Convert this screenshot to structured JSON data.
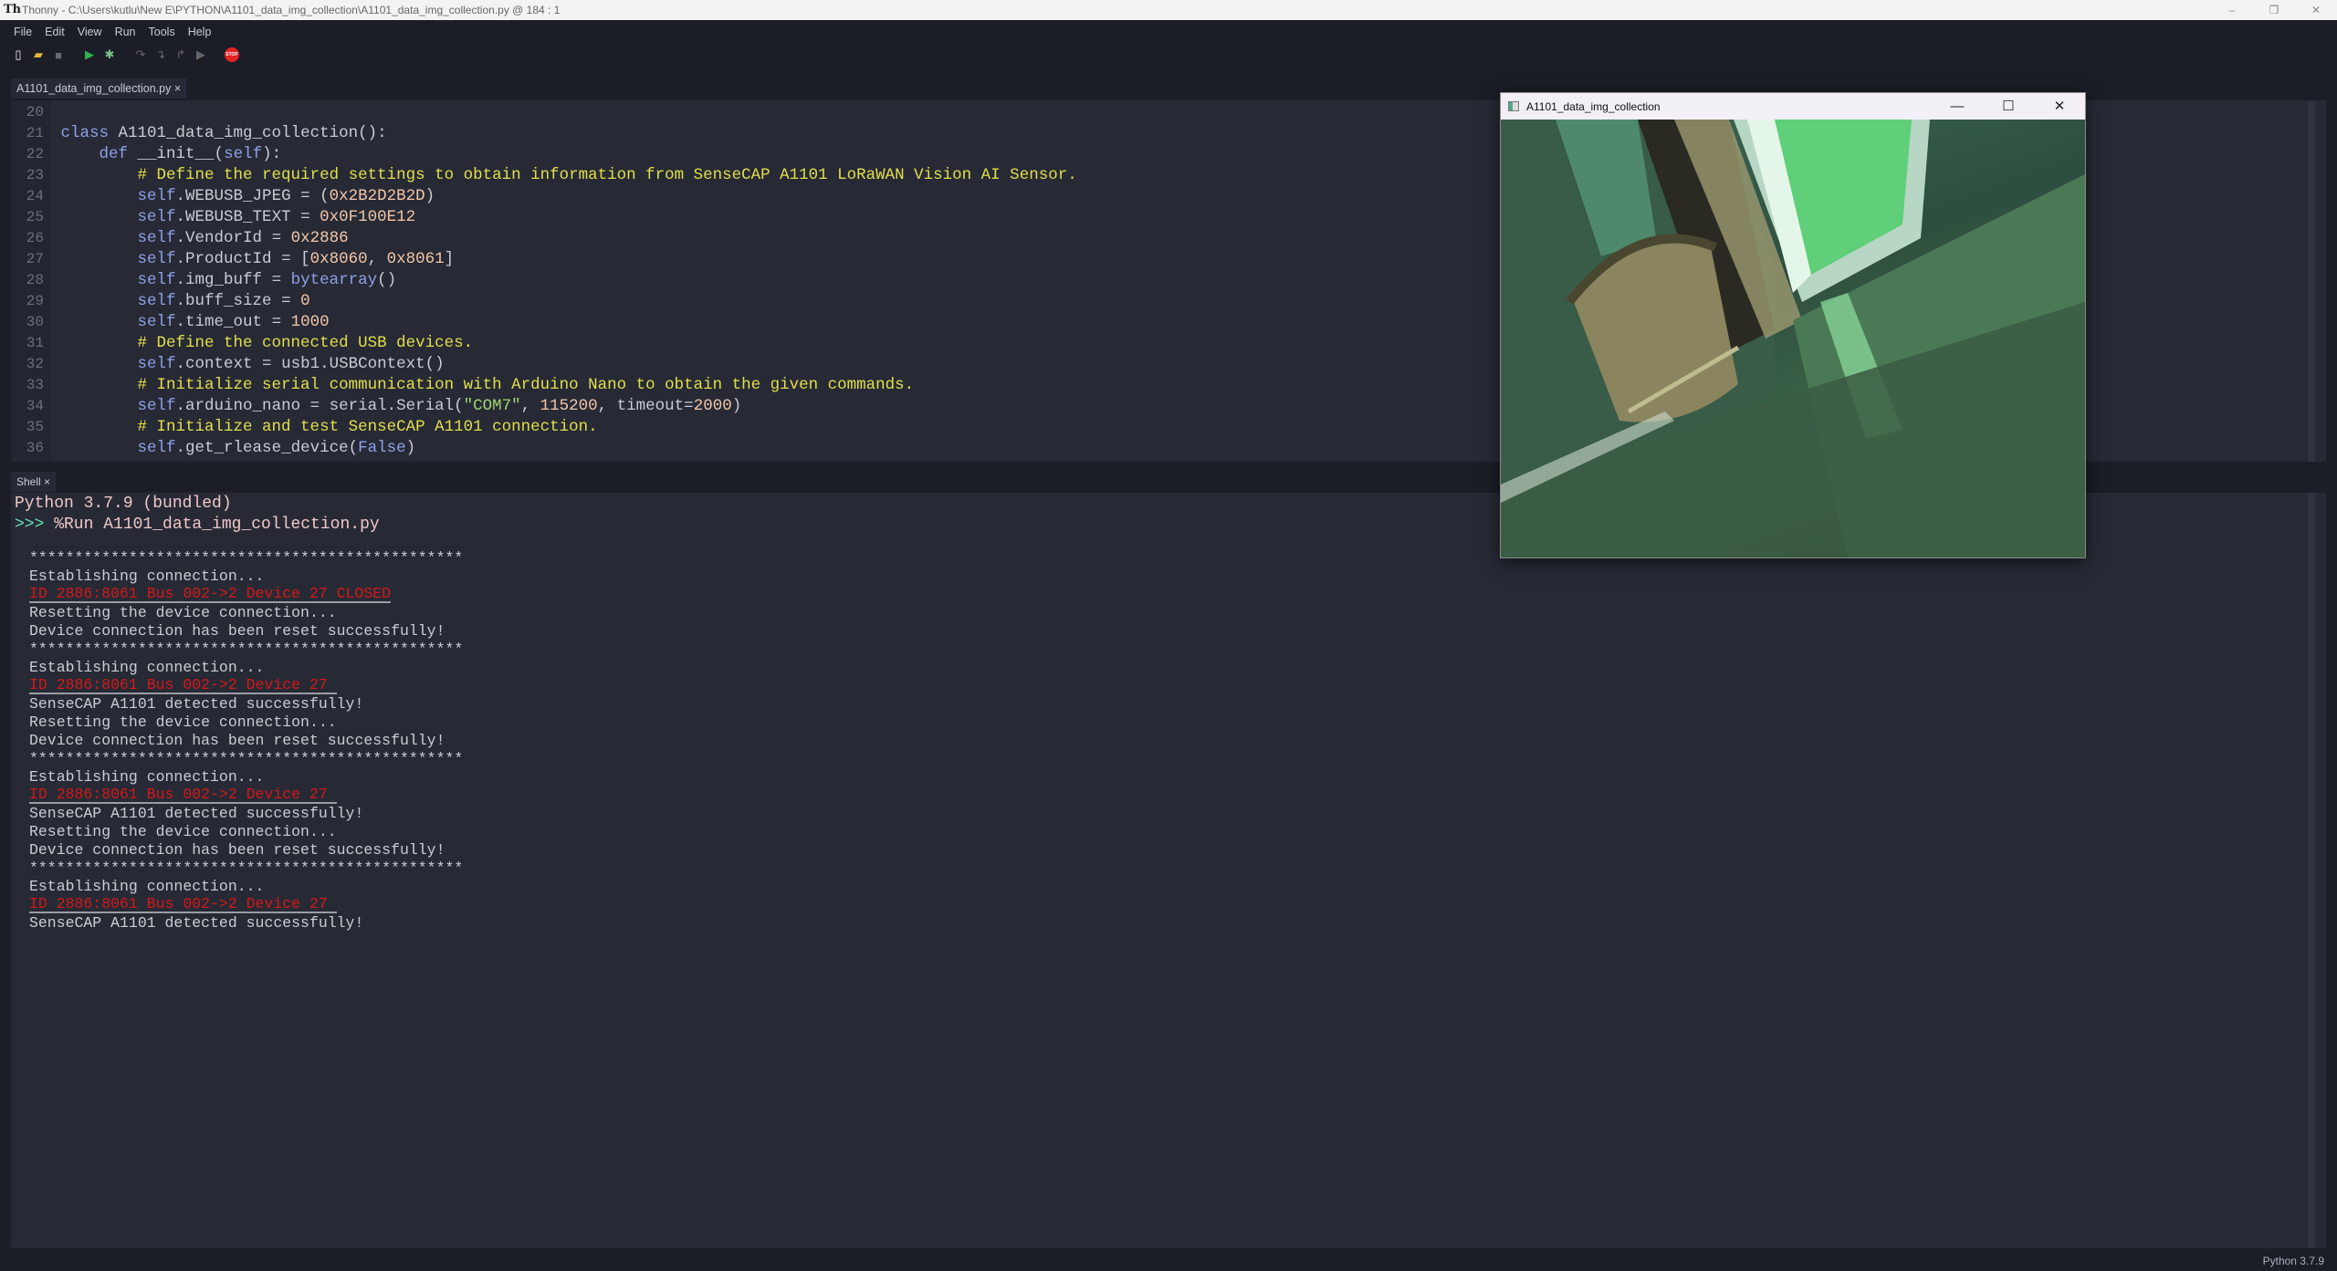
{
  "window": {
    "title": "Thonny  -  C:\\Users\\kutlu\\New E\\PYTHON\\A1101_data_img_collection\\A1101_data_img_collection.py  @  184 : 1",
    "minimize": "–",
    "maximize": "❐",
    "close": "✕"
  },
  "menu": [
    "File",
    "Edit",
    "View",
    "Run",
    "Tools",
    "Help"
  ],
  "toolbar": [
    {
      "icon": "new-file-icon",
      "glyph": "▯",
      "color": "#f0f0f0"
    },
    {
      "icon": "open-folder-icon",
      "glyph": "▰",
      "color": "#e6b63c"
    },
    {
      "icon": "save-icon",
      "glyph": "■",
      "color": "#666a75"
    },
    {
      "icon": "run-icon",
      "glyph": "▶",
      "color": "#2db34a"
    },
    {
      "icon": "debug-icon",
      "glyph": "✱",
      "color": "#7cc08a"
    },
    {
      "icon": "step-over-icon",
      "glyph": "↷",
      "color": "#666"
    },
    {
      "icon": "step-into-icon",
      "glyph": "↴",
      "color": "#666"
    },
    {
      "icon": "step-out-icon",
      "glyph": "↱",
      "color": "#666"
    },
    {
      "icon": "resume-icon",
      "glyph": "▶",
      "color": "#666"
    },
    {
      "icon": "stop-icon",
      "glyph": "STOP",
      "color": "#e52222"
    }
  ],
  "editor_tab": {
    "label": "A1101_data_img_collection.py",
    "close": "×"
  },
  "code": [
    {
      "n": "20",
      "t": []
    },
    {
      "n": "21",
      "t": [
        [
          "kw",
          "class"
        ],
        [
          "df",
          " A1101_data_img_collection():"
        ]
      ]
    },
    {
      "n": "22",
      "t": [
        [
          "df",
          "    "
        ],
        [
          "kw",
          "def"
        ],
        [
          "df",
          " __init__("
        ],
        [
          "kw",
          "self"
        ],
        [
          "df",
          "):"
        ]
      ]
    },
    {
      "n": "23",
      "t": [
        [
          "df",
          "        "
        ],
        [
          "cm",
          "# Define the required settings to obtain information from SenseCAP A1101 LoRaWAN Vision AI Sensor."
        ]
      ]
    },
    {
      "n": "24",
      "t": [
        [
          "df",
          "        "
        ],
        [
          "kw",
          "self"
        ],
        [
          "df",
          ".WEBUSB_JPEG = ("
        ],
        [
          "nu",
          "0x2B2D2B2D"
        ],
        [
          "df",
          ")"
        ]
      ]
    },
    {
      "n": "25",
      "t": [
        [
          "df",
          "        "
        ],
        [
          "kw",
          "self"
        ],
        [
          "df",
          ".WEBUSB_TEXT = "
        ],
        [
          "nu",
          "0x0F100E12"
        ]
      ]
    },
    {
      "n": "26",
      "t": [
        [
          "df",
          "        "
        ],
        [
          "kw",
          "self"
        ],
        [
          "df",
          ".VendorId = "
        ],
        [
          "nu",
          "0x2886"
        ]
      ]
    },
    {
      "n": "27",
      "t": [
        [
          "df",
          "        "
        ],
        [
          "kw",
          "self"
        ],
        [
          "df",
          ".ProductId = ["
        ],
        [
          "nu",
          "0x8060"
        ],
        [
          "df",
          ", "
        ],
        [
          "nu",
          "0x8061"
        ],
        [
          "df",
          "]"
        ]
      ]
    },
    {
      "n": "28",
      "t": [
        [
          "df",
          "        "
        ],
        [
          "kw",
          "self"
        ],
        [
          "df",
          ".img_buff = "
        ],
        [
          "kw",
          "bytearray"
        ],
        [
          "df",
          "()"
        ]
      ]
    },
    {
      "n": "29",
      "t": [
        [
          "df",
          "        "
        ],
        [
          "kw",
          "self"
        ],
        [
          "df",
          ".buff_size = "
        ],
        [
          "nu",
          "0"
        ]
      ]
    },
    {
      "n": "30",
      "t": [
        [
          "df",
          "        "
        ],
        [
          "kw",
          "self"
        ],
        [
          "df",
          ".time_out = "
        ],
        [
          "nu",
          "1000"
        ]
      ]
    },
    {
      "n": "31",
      "t": [
        [
          "df",
          "        "
        ],
        [
          "cm",
          "# Define the connected USB devices."
        ]
      ]
    },
    {
      "n": "32",
      "t": [
        [
          "df",
          "        "
        ],
        [
          "kw",
          "self"
        ],
        [
          "df",
          ".context = usb1.USBContext()"
        ]
      ]
    },
    {
      "n": "33",
      "t": [
        [
          "df",
          "        "
        ],
        [
          "cm",
          "# Initialize serial communication with Arduino Nano to obtain the given commands."
        ]
      ]
    },
    {
      "n": "34",
      "t": [
        [
          "df",
          "        "
        ],
        [
          "kw",
          "self"
        ],
        [
          "df",
          ".arduino_nano = serial.Serial("
        ],
        [
          "st",
          "\"COM7\""
        ],
        [
          "df",
          ", "
        ],
        [
          "nu",
          "115200"
        ],
        [
          "df",
          ", timeout="
        ],
        [
          "nu",
          "2000"
        ],
        [
          "df",
          ")"
        ]
      ]
    },
    {
      "n": "35",
      "t": [
        [
          "df",
          "        "
        ],
        [
          "cm",
          "# Initialize and test SenseCAP A1101 connection."
        ]
      ]
    },
    {
      "n": "36",
      "t": [
        [
          "df",
          "        "
        ],
        [
          "kw",
          "self"
        ],
        [
          "df",
          ".get_rlease_device("
        ],
        [
          "kw",
          "False"
        ],
        [
          "df",
          ")"
        ]
      ]
    }
  ],
  "shell_tab": {
    "label": "Shell",
    "close": "×"
  },
  "shell": {
    "header": "Python 3.7.9 (bundled)",
    "prompt": ">>>",
    "command": " %Run A1101_data_img_collection.py",
    "output": [
      {
        "k": "out",
        "t": "************************************************"
      },
      {
        "k": "out",
        "t": "Establishing connection..."
      },
      {
        "k": "err",
        "t": "ID 2886:8061 Bus 002->2 Device 27 CLOSED"
      },
      {
        "k": "out",
        "t": "Resetting the device connection..."
      },
      {
        "k": "out",
        "t": "Device connection has been reset successfully!"
      },
      {
        "k": "out",
        "t": "************************************************"
      },
      {
        "k": "out",
        "t": "Establishing connection..."
      },
      {
        "k": "err",
        "t": "ID 2886:8061 Bus 002->2 Device 27 "
      },
      {
        "k": "out",
        "t": "SenseCAP A1101 detected successfully!"
      },
      {
        "k": "out",
        "t": "Resetting the device connection..."
      },
      {
        "k": "out",
        "t": "Device connection has been reset successfully!"
      },
      {
        "k": "out",
        "t": "************************************************"
      },
      {
        "k": "out",
        "t": "Establishing connection..."
      },
      {
        "k": "err",
        "t": "ID 2886:8061 Bus 002->2 Device 27 "
      },
      {
        "k": "out",
        "t": "SenseCAP A1101 detected successfully!"
      },
      {
        "k": "out",
        "t": "Resetting the device connection..."
      },
      {
        "k": "out",
        "t": "Device connection has been reset successfully!"
      },
      {
        "k": "out",
        "t": "************************************************"
      },
      {
        "k": "out",
        "t": "Establishing connection..."
      },
      {
        "k": "err",
        "t": "ID 2886:8061 Bus 002->2 Device 27 "
      },
      {
        "k": "out",
        "t": "SenseCAP A1101 detected successfully!"
      }
    ]
  },
  "status": {
    "interpreter": "Python 3.7.9"
  },
  "camera_window": {
    "title": "A1101_data_img_collection",
    "minimize": "—",
    "maximize": "☐",
    "close": "✕"
  }
}
